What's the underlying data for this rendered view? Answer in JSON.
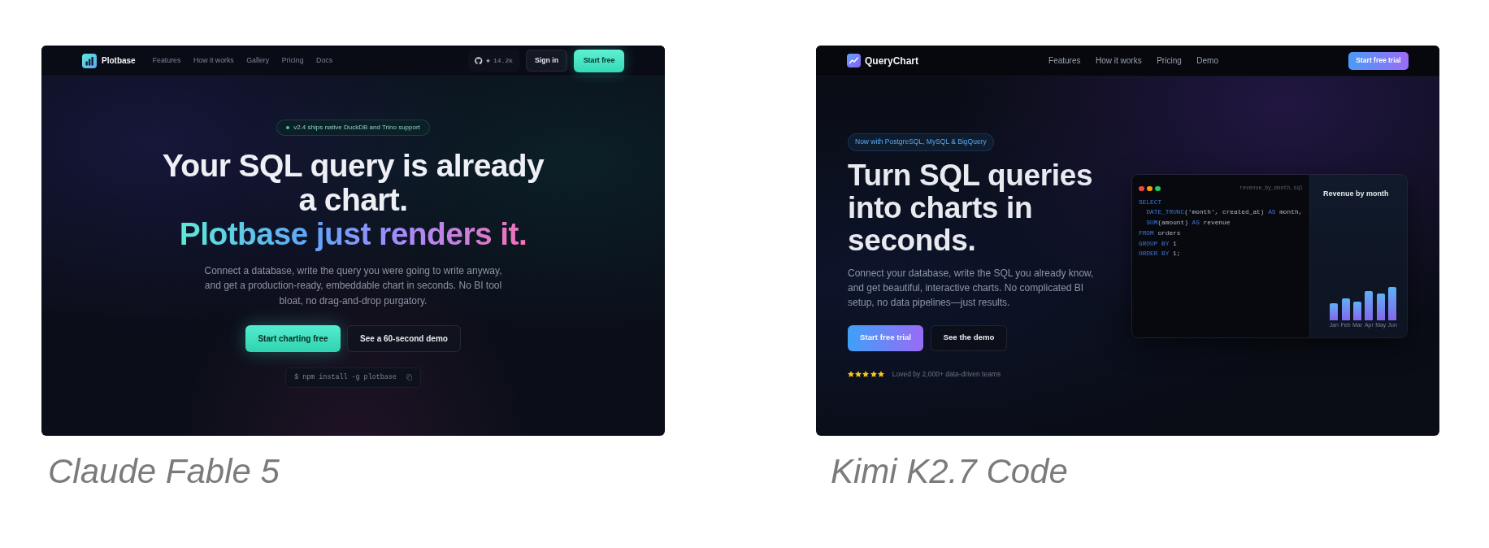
{
  "entries": [
    {
      "kind": "centered",
      "nav": {
        "brand": "Plotbase",
        "links": [
          "Features",
          "How it works",
          "Gallery",
          "Pricing",
          "Docs"
        ],
        "github_stars": "14.2k",
        "sign_in": "Sign in",
        "cta": "Start free"
      },
      "hero": {
        "badge": "v2.4 ships native DuckDB and Trino support",
        "headline": "Your SQL query is already a chart.",
        "headline_accent": "Plotbase just renders it.",
        "description": "Connect a database, write the query you were going to write anyway, and get a production-ready, embeddable chart in seconds. No BI tool bloat, no drag-and-drop purgatory.",
        "primary_button": "Start charting free",
        "secondary_button": "See a 60-second demo",
        "install_command": "$ npm install -g plotbase"
      },
      "caption": "Claude Fable 5"
    },
    {
      "kind": "split",
      "nav": {
        "brand": "QueryChart",
        "links": [
          "Features",
          "How it works",
          "Pricing",
          "Demo"
        ],
        "cta": "Start free trial"
      },
      "hero": {
        "badge": "Now with PostgreSQL, MySQL & BigQuery",
        "headline": "Turn SQL queries into charts in seconds.",
        "description": "Connect your database, write the SQL you already know, and get beautiful, interactive charts. No complicated BI setup, no data pipelines—just results.",
        "primary_button": "Start free trial",
        "secondary_button": "See the demo",
        "rating": {
          "stars": 5,
          "text": "Loved by 2,000+ data-driven teams"
        }
      },
      "preview": {
        "filename": "revenue_by_month.sql",
        "code": [
          {
            "tokens": [
              {
                "text": "SELECT",
                "kind": "keyword"
              }
            ],
            "children": [
              {
                "tokens": [
                  {
                    "text": "DATE_TRUNC",
                    "kind": "keyword"
                  },
                  {
                    "text": "('month', created_at) ",
                    "kind": "plain"
                  },
                  {
                    "text": "AS",
                    "kind": "keyword"
                  },
                  {
                    "text": " month,",
                    "kind": "plain"
                  }
                ]
              },
              {
                "tokens": [
                  {
                    "text": "SUM",
                    "kind": "keyword"
                  },
                  {
                    "text": "(amount) ",
                    "kind": "plain"
                  },
                  {
                    "text": "AS",
                    "kind": "keyword"
                  },
                  {
                    "text": " revenue",
                    "kind": "plain"
                  }
                ]
              }
            ]
          },
          {
            "tokens": [
              {
                "text": "FROM",
                "kind": "keyword"
              },
              {
                "text": " orders",
                "kind": "plain"
              }
            ]
          },
          {
            "tokens": [
              {
                "text": "GROUP BY",
                "kind": "keyword"
              },
              {
                "text": " 1",
                "kind": "plain"
              }
            ]
          },
          {
            "tokens": [
              {
                "text": "ORDER BY",
                "kind": "keyword"
              },
              {
                "text": " 1;",
                "kind": "plain"
              }
            ]
          }
        ],
        "chart_title": "Revenue by month",
        "bar_labels": [
          "Jan",
          "Feb",
          "Mar",
          "Apr",
          "May",
          "Jun"
        ]
      },
      "caption": "Kimi K2.7 Code"
    }
  ]
}
